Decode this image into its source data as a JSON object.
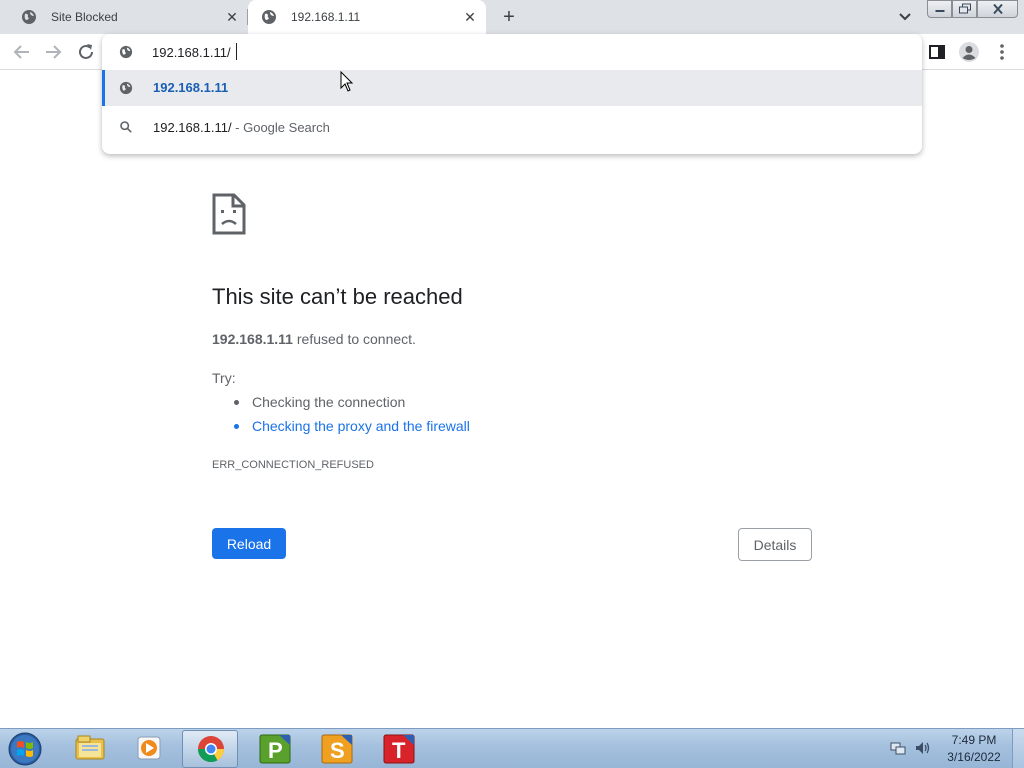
{
  "browser": {
    "tabs": [
      {
        "title": "Site Blocked",
        "active": false
      },
      {
        "title": "192.168.1.11",
        "active": true
      }
    ],
    "new_tab_label": "+"
  },
  "omnibox": {
    "value": "192.168.1.11/",
    "suggestions": [
      {
        "text": "192.168.1.11",
        "icon": "globe-icon",
        "selected": true
      },
      {
        "text": "192.168.1.11/",
        "description": " - Google Search",
        "icon": "search-icon",
        "selected": false
      }
    ]
  },
  "error_page": {
    "title": "This site can’t be reached",
    "host": "192.168.1.11",
    "summary_suffix": " refused to connect.",
    "try_label": "Try:",
    "suggestions": [
      {
        "text": "Checking the connection",
        "is_link": false
      },
      {
        "text": "Checking the proxy and the firewall",
        "is_link": true
      }
    ],
    "error_code": "ERR_CONNECTION_REFUSED",
    "reload_label": "Reload",
    "details_label": "Details"
  },
  "taskbar": {
    "apps": [
      "explorer-icon",
      "media-player-icon",
      "chrome-icon",
      "p-app-icon",
      "s-app-icon",
      "t-app-icon"
    ],
    "clock_time": "7:49 PM",
    "clock_date": "3/16/2022"
  },
  "colors": {
    "accent": "#1a73e8",
    "tabstrip": "#dee1e6",
    "taskbar": "#a4c0de"
  }
}
